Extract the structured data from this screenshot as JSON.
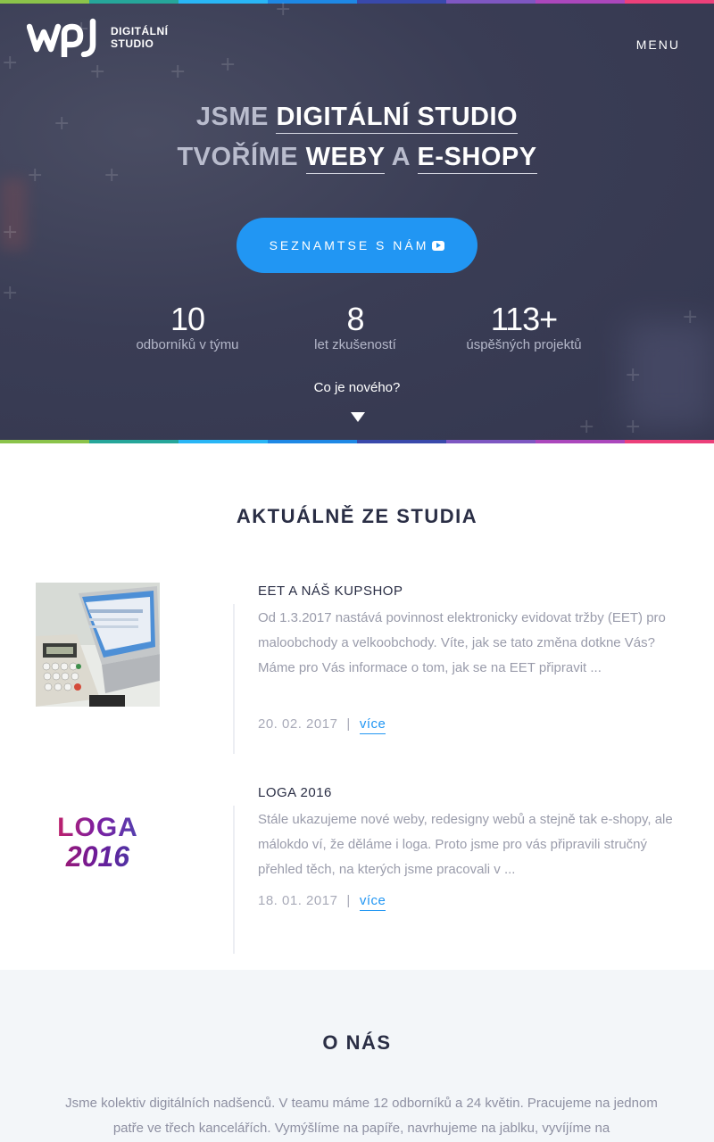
{
  "brand": {
    "logo_text": "wpj",
    "subtitle_line1": "DIGITÁLNÍ",
    "subtitle_line2": "STUDIO"
  },
  "nav": {
    "menu_label": "MENU"
  },
  "hero": {
    "line1_prefix": "JSME",
    "line1_highlight": "DIGITÁLNÍ STUDIO",
    "line2_prefix": "TVOŘÍME",
    "line2_highlight1": "WEBY",
    "line2_joiner": "A",
    "line2_highlight2": "E-SHOPY",
    "cta_label": "SEZNAMTSE S NÁM",
    "stats": [
      {
        "value": "10",
        "label": "odborníků v týmu"
      },
      {
        "value": "8",
        "label": "let zkušeností"
      },
      {
        "value": "113+",
        "label": "úspěšných projektů"
      }
    ],
    "whats_new": "Co je nového?"
  },
  "news": {
    "title": "AKTUÁLNĚ ZE STUDIA",
    "articles": [
      {
        "title": "EET A NÁŠ KUPSHOP",
        "text": "Od 1.3.2017 nastává povinnost elektronicky evidovat tržby (EET) pro maloobchody a velkoobchody. Víte, jak se tato změna dotkne Vás? Máme pro Vás informace o tom, jak se na EET připravit ...",
        "date": "20. 02. 2017",
        "separator": "|",
        "more": "více"
      },
      {
        "title": "LOGA 2016",
        "text": "Stále ukazujeme nové weby, redesigny webů a stejně tak e-shopy, ale málokdo ví, že děláme i loga. Proto jsme pro vás připravili stručný přehled těch, na kterých jsme pracovali v ...",
        "date": "18. 01. 2017",
        "separator": "|",
        "more": "více",
        "thumb_line1": "LOGA",
        "thumb_line2": "2016"
      }
    ]
  },
  "about": {
    "title": "O NÁS",
    "text": "Jsme kolektiv digitálních nadšenců. V teamu máme 12 odborníků a 24 květin. Pracujeme na jednom patře ve třech kancelářích. Vymýšlíme na papíře, navrhujeme na jablku, vyvíjíme na"
  },
  "colors": {
    "accent": "#2196f3",
    "hero_bg": "#3a3d55",
    "rainbow": [
      "#8bc34a",
      "#26a69a",
      "#29b6f6",
      "#1e88e5",
      "#3949ab",
      "#7e57c2",
      "#ab47bc",
      "#ec407a"
    ]
  }
}
